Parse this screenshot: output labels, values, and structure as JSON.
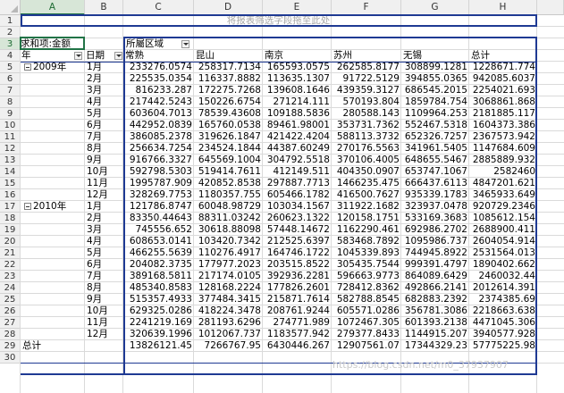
{
  "sheet": {
    "columns": [
      "A",
      "B",
      "C",
      "D",
      "E",
      "F",
      "G",
      "H"
    ],
    "rows": [
      "1",
      "2",
      "3",
      "4",
      "5",
      "6",
      "7",
      "8",
      "9",
      "10",
      "11",
      "12",
      "13",
      "14",
      "15",
      "16",
      "17",
      "18",
      "19",
      "20",
      "21",
      "22",
      "23",
      "24",
      "25",
      "26",
      "27",
      "28",
      "29",
      "30"
    ],
    "selected_column": "A",
    "selected_row": "3"
  },
  "pivot": {
    "filter_placeholder": "将报表筛选字段拖至此处",
    "value_field": "求和项:金额",
    "col_field": "所屬区域",
    "row_field_year": "年",
    "row_field_date": "日期",
    "regions": [
      "常熟",
      "昆山",
      "南京",
      "苏州",
      "无锡",
      "总计"
    ],
    "groups": [
      {
        "year": "2009年",
        "rows": [
          {
            "month": "1月",
            "values": [
              "233276.0574",
              "258317.7134",
              "165593.0575",
              "262585.8177",
              "308899.1281",
              "1228671.774"
            ]
          },
          {
            "month": "2月",
            "values": [
              "225535.0354",
              "116337.8882",
              "113635.1307",
              "91722.5129",
              "394855.0365",
              "942085.6037"
            ]
          },
          {
            "month": "3月",
            "values": [
              "816233.287",
              "172275.7268",
              "139608.1646",
              "439359.3127",
              "686545.2015",
              "2254021.693"
            ]
          },
          {
            "month": "4月",
            "values": [
              "217442.5243",
              "150226.6754",
              "271214.111",
              "570193.804",
              "1859784.754",
              "3068861.868"
            ]
          },
          {
            "month": "5月",
            "values": [
              "603604.7013",
              "78539.43608",
              "109188.5836",
              "280588.143",
              "1109964.253",
              "2181885.117"
            ]
          },
          {
            "month": "6月",
            "values": [
              "442952.0839",
              "165760.0538",
              "89461.98001",
              "353731.7362",
              "552467.5318",
              "1604373.386"
            ]
          },
          {
            "month": "7月",
            "values": [
              "386085.2378",
              "319626.1847",
              "421422.4204",
              "588113.3732",
              "652326.7257",
              "2367573.942"
            ]
          },
          {
            "month": "8月",
            "values": [
              "256634.7254",
              "234524.1844",
              "44387.60249",
              "270176.5563",
              "341961.5405",
              "1147684.609"
            ]
          },
          {
            "month": "9月",
            "values": [
              "916766.3327",
              "645569.1004",
              "304792.5518",
              "370106.4005",
              "648655.5467",
              "2885889.932"
            ]
          },
          {
            "month": "10月",
            "values": [
              "592798.5303",
              "519414.7611",
              "412149.511",
              "404350.0907",
              "653747.1067",
              "2582460"
            ]
          },
          {
            "month": "11月",
            "values": [
              "1995787.909",
              "420852.8538",
              "297887.7713",
              "1466235.475",
              "666437.6113",
              "4847201.621"
            ]
          },
          {
            "month": "12月",
            "values": [
              "328269.7753",
              "1180357.755",
              "605466.1782",
              "416500.7627",
              "935339.1783",
              "3465933.649"
            ]
          }
        ]
      },
      {
        "year": "2010年",
        "rows": [
          {
            "month": "1月",
            "values": [
              "121786.8747",
              "60048.98729",
              "103034.1567",
              "311922.1682",
              "323937.0478",
              "920729.2346"
            ]
          },
          {
            "month": "2月",
            "values": [
              "83350.44643",
              "88311.03242",
              "260623.1322",
              "120158.1751",
              "533169.3683",
              "1085612.154"
            ]
          },
          {
            "month": "3月",
            "values": [
              "745556.652",
              "30618.88098",
              "57448.14672",
              "1162290.461",
              "692986.2702",
              "2688900.411"
            ]
          },
          {
            "month": "4月",
            "values": [
              "608653.0141",
              "103420.7342",
              "212525.6397",
              "583468.7892",
              "1095986.737",
              "2604054.914"
            ]
          },
          {
            "month": "5月",
            "values": [
              "466255.5639",
              "110276.4917",
              "164746.1722",
              "1045339.893",
              "744945.8922",
              "2531564.013"
            ]
          },
          {
            "month": "6月",
            "values": [
              "204082.3735",
              "177977.2023",
              "203515.8522",
              "305435.7544",
              "999391.4797",
              "1890402.662"
            ]
          },
          {
            "month": "7月",
            "values": [
              "389168.5811",
              "217174.0105",
              "392936.2281",
              "596663.9773",
              "864089.6429",
              "2460032.44"
            ]
          },
          {
            "month": "8月",
            "values": [
              "485340.8583",
              "128168.2224",
              "177826.2601",
              "728412.8362",
              "492866.2141",
              "2012614.391"
            ]
          },
          {
            "month": "9月",
            "values": [
              "515357.4933",
              "377484.3415",
              "215871.7614",
              "582788.8545",
              "682883.2392",
              "2374385.69"
            ]
          },
          {
            "month": "10月",
            "values": [
              "629325.0286",
              "418224.3478",
              "208761.9244",
              "605571.0286",
              "356781.3086",
              "2218663.638"
            ]
          },
          {
            "month": "11月",
            "values": [
              "2241219.169",
              "281193.6296",
              "274771.989",
              "1072467.305",
              "601393.2138",
              "4471045.306"
            ]
          },
          {
            "month": "12月",
            "values": [
              "320639.1996",
              "1012067.737",
              "1183577.942",
              "279377.8433",
              "1144915.207",
              "3940577.928"
            ]
          }
        ]
      }
    ],
    "total_label": "总计",
    "totals": [
      "13826121.45",
      "7266767.95",
      "6430446.267",
      "12907561.07",
      "17344329.23",
      "57775225.98"
    ]
  },
  "watermark": "https://blog.csdn.net/m0_37937907",
  "colors": {
    "border_blue": "#1f3a93",
    "excel_green": "#217346",
    "header_gray": "#f0f0f0",
    "grid": "#dadada"
  }
}
